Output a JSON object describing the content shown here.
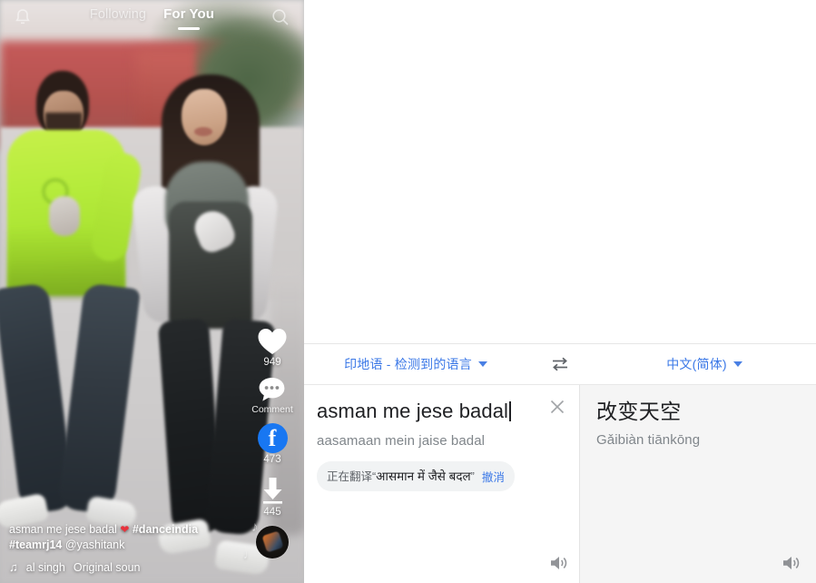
{
  "video": {
    "nav": {
      "bell_icon": "bell-icon",
      "search_icon": "search-icon",
      "tab_following": "Following",
      "tab_foryou": "For You"
    },
    "actions": {
      "like_icon": "heart-icon",
      "like_count": "949",
      "comment_icon": "comment-bubble-icon",
      "comment_label": "Comment",
      "share_icon": "facebook-icon",
      "share_glyph": "f",
      "share_count": "473",
      "download_icon": "download-arrow-icon",
      "download_count": "445",
      "disc_icon": "music-disc-icon"
    },
    "caption": {
      "line1_text": "asman me jese badal",
      "line1_emoji": "❤",
      "line1_tag": "#danceindia",
      "line2_tag": "#teamrj14",
      "line2_mention": "@yashitank",
      "music_note_icon": "music-note-icon",
      "music_artist": "al singh",
      "music_title": "Original soun"
    }
  },
  "translate": {
    "lang_bar": {
      "source_lang": "印地语 - 检测到的语言",
      "swap_icon": "swap-arrows-icon",
      "target_lang": "中文(简体)"
    },
    "source": {
      "input_value": "asman me jese badal",
      "transliteration": "aasamaan mein jaise badal",
      "clear_icon": "close-x-icon",
      "listen_icon": "speaker-icon",
      "chip": {
        "prefix": "正在翻译“",
        "original": "आसमान में जैसे बदल",
        "suffix": "”",
        "undo": "撤消"
      }
    },
    "target": {
      "translated_text": "改变天空",
      "pinyin": "Gǎibiàn tiānkōng",
      "listen_icon": "speaker-icon"
    }
  },
  "colors": {
    "link_blue": "#3b78e7",
    "facebook_blue": "#1877F2",
    "heart_red": "#e8323c",
    "panel_grey": "#f5f5f5",
    "chip_grey": "#f1f3f4"
  }
}
